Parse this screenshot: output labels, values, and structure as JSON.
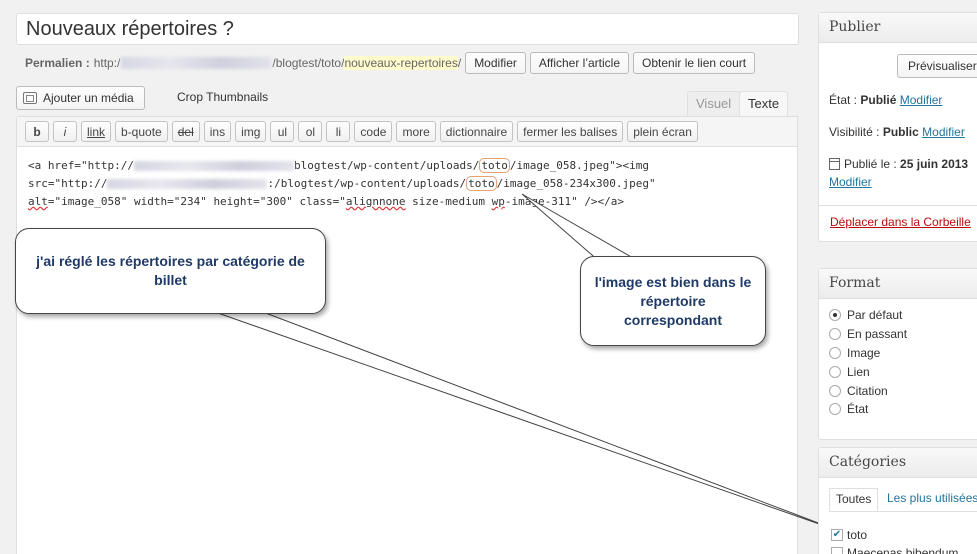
{
  "post": {
    "title": "Nouveaux répertoires ?",
    "permalink_label": "Permalien :",
    "permalink_prefix": "http:/",
    "permalink_path": "/blogtest/toto/",
    "permalink_slug": "nouveaux-repertoires",
    "permalink_suffix": "/",
    "btn_modify": "Modifier",
    "btn_view": "Afficher l’article",
    "btn_shortlink": "Obtenir le lien court"
  },
  "editor": {
    "add_media": "Ajouter un média",
    "crop_thumbnails": "Crop Thumbnails",
    "tab_visual": "Visuel",
    "tab_text": "Texte",
    "quicktags": [
      "b",
      "i",
      "link",
      "b-quote",
      "del",
      "ins",
      "img",
      "ul",
      "ol",
      "li",
      "code",
      "more",
      "dictionnaire",
      "fermer les balises",
      "plein écran"
    ],
    "code": {
      "l1_a": "<a href=\"http://",
      "l1_b": "blogtest/wp-content/uploads/",
      "l1_hl": "toto",
      "l1_c": "/image_058.jpeg\"><img",
      "l2_a": "src=\"http://",
      "l2_b": ":/blogtest/wp-content/uploads/",
      "l2_hl": "toto",
      "l2_c": "/image_058-234x300.jpeg\"",
      "l3_alt": "alt",
      "l3_a": "=\"image_058\" width=\"234\" height=\"300\" class=\"",
      "l3_align": "alignnone",
      "l3_b": " size-medium ",
      "l3_wp": "wp",
      "l3_c": "-image-311\" /></a>"
    }
  },
  "callouts": {
    "left": "j'ai réglé les répertoires par catégorie de billet",
    "right": "l'image est bien dans le répertoire correspondant"
  },
  "publish": {
    "title": "Publier",
    "preview": "Prévisualiser",
    "status_label": "État :",
    "status_value": "Publié",
    "visibility_label": "Visibilité :",
    "visibility_value": "Public",
    "published_label": "Publié le :",
    "published_date": "25 juin 2013",
    "modify": "Modifier",
    "trash": "Déplacer dans la Corbeille"
  },
  "format": {
    "title": "Format",
    "options": [
      "Par défaut",
      "En passant",
      "Image",
      "Lien",
      "Citation",
      "État"
    ],
    "selected_index": 0
  },
  "categories": {
    "title": "Catégories",
    "tab_all": "Toutes",
    "tab_popular": "Les plus utilisées",
    "items": [
      {
        "label": "toto",
        "checked": true
      },
      {
        "label": "Maecenas bibendum",
        "checked": false
      }
    ]
  },
  "colors": {
    "link": "#21759b",
    "trash": "#bc0b0b",
    "callout_text": "#1f3a66",
    "slug_highlight": "#fffbcc",
    "code_highlight": "#e8a070"
  }
}
